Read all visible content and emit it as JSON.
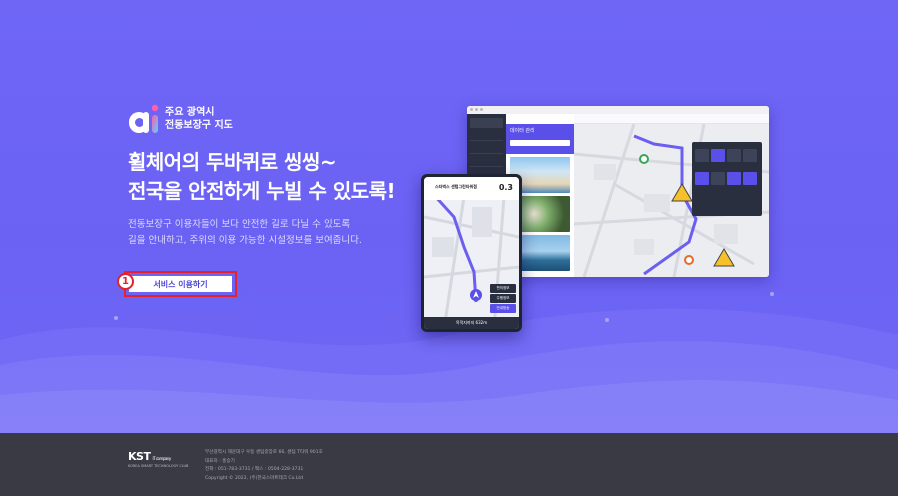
{
  "logo": {
    "mark": "ai",
    "line1": "주요 광역시",
    "line2": "전동보장구 지도"
  },
  "hero": {
    "headline_line1": "휠체어의 두바퀴로 씽씽~",
    "headline_line2": "전국을 안전하게 누빌 수 있도록!",
    "desc_line1": "전동보장구 이용자들이 보다 안전한 길로 다닐 수 있도록",
    "desc_line2": "길을 안내하고, 주위의 이용 가능한 시설정보를 보여줍니다.",
    "service_button": "서비스 이용하기",
    "step_marker": "1"
  },
  "mockup": {
    "panel_title": "데이터 관리",
    "phone_place": "스타벅스 센텀그린타워점",
    "phone_distance": "0.3",
    "phone_tabs": [
      "편의정보",
      "주행정보",
      "안내방송"
    ],
    "phone_bottom": "목적지까지 632m"
  },
  "footer": {
    "brand": "KST",
    "brand_suffix": "IT company",
    "brand_sub": "KOREA SMART TECHNOLOGY CLUB",
    "lines": [
      "부산광역시 해운대구 우동 센텀중앙로 66, 센텀 T타워 901호",
      "대표자 : 홍승기",
      "전화 : 051-783-3731 / 팩스 : 0504-228-3731",
      "Copyright © 2022, (주)한국스마트테크 Co.Ltd"
    ]
  },
  "colors": {
    "accent": "#6c63f5",
    "highlight": "#e8202a",
    "footer": "#3a3a45"
  }
}
